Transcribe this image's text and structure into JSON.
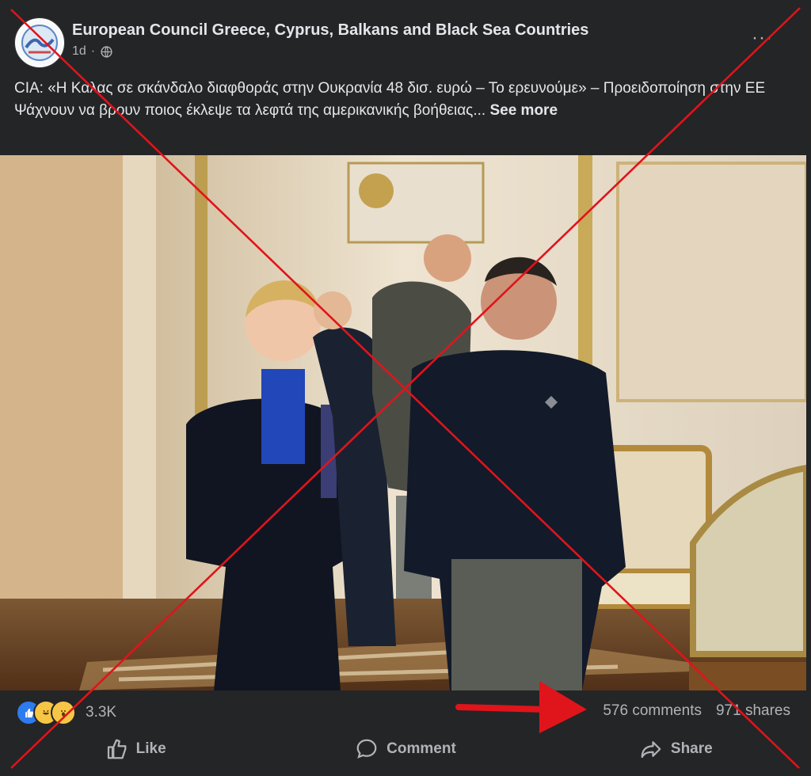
{
  "post": {
    "page_name": "European Council Greece, Cyprus, Balkans and Black Sea Countries",
    "time": "1d",
    "more_label": "···",
    "text_line1": "CIA: «Η Καλας σε σκάνδαλο διαφθοράς στην Ουκρανία 48 δισ. ευρώ – Το ερευνούμε» – Προειδοποίηση στην ΕΕ",
    "text_line2": "Ψάχνουν να βρουν ποιος έκλεψε τα λεφτά της αμερικανικής βοήθειας...",
    "see_more": "See more"
  },
  "engagement": {
    "reaction_count": "3.3K",
    "comments": "576 comments",
    "shares": "971 shares"
  },
  "actions": {
    "like": "Like",
    "comment": "Comment",
    "share": "Share"
  },
  "icons": [
    "globe-icon",
    "more-icon",
    "like-reaction-icon",
    "haha-reaction-icon",
    "wow-reaction-icon",
    "like-icon",
    "comment-icon",
    "share-icon"
  ],
  "colors": {
    "background": "#242526",
    "text": "#e4e6eb",
    "secondary": "#b0b3b8",
    "cross": "#e0141b"
  }
}
